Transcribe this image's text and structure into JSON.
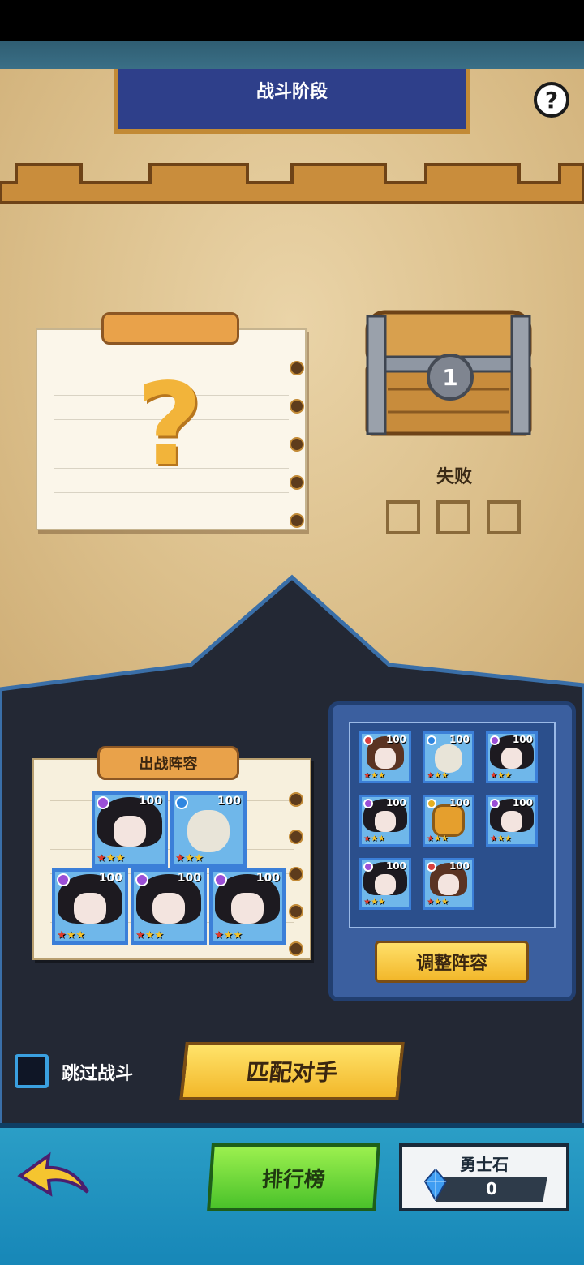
{
  "header": {
    "title": "战斗阶段",
    "help_symbol": "?"
  },
  "mystery_note": {
    "symbol": "?"
  },
  "chest": {
    "number": "1",
    "status": "失败",
    "slots": 3
  },
  "lineup": {
    "title": "出战阵容",
    "heroes": [
      {
        "level": "100",
        "type": "dark-hair-girl",
        "element": "purple",
        "stars": 3
      },
      {
        "level": "100",
        "type": "pirate-skeleton",
        "element": "blue",
        "stars": 3
      },
      {
        "level": "100",
        "type": "dark-hair-girl",
        "element": "purple",
        "stars": 3
      },
      {
        "level": "100",
        "type": "dark-hair-girl",
        "element": "purple",
        "stars": 3
      },
      {
        "level": "100",
        "type": "dark-hair-girl",
        "element": "purple",
        "stars": 3
      }
    ]
  },
  "roster": {
    "heroes": [
      {
        "level": "100",
        "type": "brown-hair-girl",
        "element": "red",
        "stars": 3
      },
      {
        "level": "100",
        "type": "pirate-skeleton",
        "element": "blue",
        "stars": 3
      },
      {
        "level": "100",
        "type": "dark-hair-girl",
        "element": "purple",
        "stars": 3
      },
      {
        "level": "100",
        "type": "dark-hair-girl",
        "element": "purple",
        "stars": 3
      },
      {
        "level": "100",
        "type": "robot",
        "element": "yellow",
        "stars": 3
      },
      {
        "level": "100",
        "type": "dark-hair-girl",
        "element": "purple",
        "stars": 3
      },
      {
        "level": "100",
        "type": "dark-hair-girl",
        "element": "purple",
        "stars": 3
      },
      {
        "level": "100",
        "type": "brown-hair-girl",
        "element": "red",
        "stars": 3
      }
    ],
    "adjust_label": "调整阵容"
  },
  "skip": {
    "label": "跳过战斗",
    "checked": false
  },
  "match_label": "匹配对手",
  "footer": {
    "ranking_label": "排行榜",
    "currency_label": "勇士石",
    "currency_value": "0"
  },
  "colors": {
    "banner": "#2e3f8a",
    "parchment": "#dcc08c",
    "dark_panel": "#232834",
    "yellow_button": "#f2b72a",
    "green_button": "#4ac22a",
    "blue_footer": "#1686b7"
  }
}
